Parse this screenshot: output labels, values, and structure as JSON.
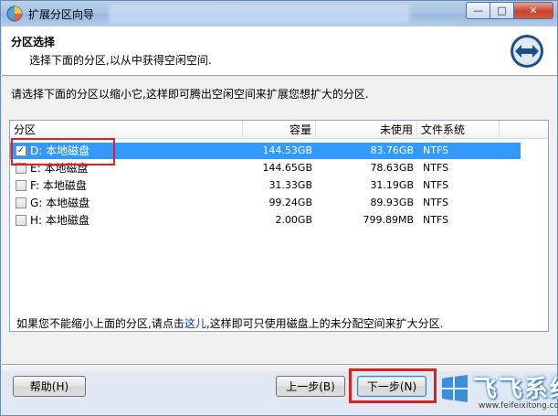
{
  "window": {
    "title": "扩展分区向导",
    "minimize_glyph": "—",
    "maximize_glyph": "□",
    "close_glyph": "✕"
  },
  "header": {
    "title": "分区选择",
    "subtitle": "选择下面的分区,以从中获得空闲空间."
  },
  "instruction": "请选择下面的分区以缩小它,这样即可腾出空闲空间来扩展您想扩大的分区.",
  "list": {
    "columns": [
      "分区",
      "容量",
      "未使用",
      "文件系统"
    ],
    "rows": [
      {
        "partition": "D: 本地磁盘",
        "capacity": "144.53GB",
        "unused": "83.76GB",
        "fs": "NTFS",
        "checked": "✓",
        "selected": true
      },
      {
        "partition": "E: 本地磁盘",
        "capacity": "144.65GB",
        "unused": "78.63GB",
        "fs": "NTFS",
        "checked": "",
        "selected": false
      },
      {
        "partition": "F: 本地磁盘",
        "capacity": "31.33GB",
        "unused": "31.19GB",
        "fs": "NTFS",
        "checked": "",
        "selected": false
      },
      {
        "partition": "G: 本地磁盘",
        "capacity": "99.24GB",
        "unused": "89.93GB",
        "fs": "NTFS",
        "checked": "",
        "selected": false
      },
      {
        "partition": "H: 本地磁盘",
        "capacity": "2.00GB",
        "unused": "799.89MB",
        "fs": "NTFS",
        "checked": "",
        "selected": false
      }
    ]
  },
  "note": {
    "before": "如果您不能缩小上面的分区,请点击",
    "link": "这儿",
    "after": ",这样即可只使用磁盘上的未分配空间来扩大分区."
  },
  "buttons": {
    "help": "帮助(H)",
    "prev": "上一步(B)",
    "next": "下一步(N)"
  },
  "watermark": {
    "text": "飞飞系统",
    "url": "www.feifeixitong.com"
  },
  "colors": {
    "selection": "#3399ff",
    "highlight": "#e0211b",
    "link": "#0033cc"
  },
  "icons": {
    "app": "partition-app-icon",
    "header": "resize-arrows-icon",
    "checkbox": "checkbox-icon"
  }
}
